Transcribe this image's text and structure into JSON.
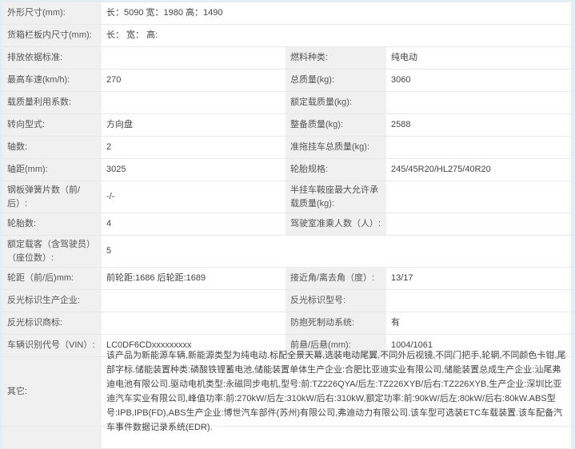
{
  "rows": [
    {
      "l1": "外形尺寸(mm):",
      "v1": "长：5090 宽：1980 高：1490"
    },
    {
      "l1": "货箱栏板内尺寸(mm):",
      "v1": "长： 宽： 高:"
    },
    {
      "l1": "排放依据标准:",
      "v1": "",
      "l2": "燃料种类:",
      "v2": "纯电动"
    },
    {
      "l1": "最高车速(km/h):",
      "v1": "270",
      "l2": "总质量(kg):",
      "v2": "3060"
    },
    {
      "l1": "载质量利用系数:",
      "v1": "",
      "l2": "额定载质量(kg):",
      "v2": ""
    },
    {
      "l1": "转向型式:",
      "v1": "方向盘",
      "l2": "整备质量(kg):",
      "v2": "2588"
    },
    {
      "l1": "轴数:",
      "v1": "2",
      "l2": "准拖挂车总质量(kg):",
      "v2": ""
    },
    {
      "l1": "轴距(mm):",
      "v1": "3025",
      "l2": "轮胎规格:",
      "v2": "245/45R20/HL275/40R20"
    },
    {
      "l1": "钢板弹簧片数（前/后）:",
      "v1": "-/-",
      "l2": "半挂车鞍座最大允许承载质量(kg):",
      "v2": ""
    },
    {
      "l1": "轮胎数:",
      "v1": "4",
      "l2": "驾驶室准乘人数（人）:",
      "v2": ""
    },
    {
      "l1": "额定载客（含驾驶员）（座位数）:",
      "v1": "5"
    },
    {
      "l1": "轮距（前/后)mm:",
      "v1": "前轮距:1686 后轮距:1689",
      "l2": "接近角/离去角（度）:",
      "v2": "13/17"
    },
    {
      "l1": "反光标识生产企业:",
      "v1": "",
      "l2": "反光标识型号:",
      "v2": ""
    },
    {
      "l1": "反光标识商标:",
      "v1": "",
      "l2": "防抱死制动系统:",
      "v2": "有"
    },
    {
      "l1": "车辆识别代号（VIN）:",
      "v1": "LC0DF6CDxxxxxxxxx",
      "l2": "前悬/后悬(mm):",
      "v2": "1004/1061"
    },
    {
      "l1": "其它:",
      "v1": "该产品为新能源车辆,新能源类型为纯电动.标配全景天幕,选装电动尾翼,不同外后视镜,不同门把手,轮辋,不同颜色卡钳,尾部字标.储能装置种类:磷酸铁锂蓄电池,储能装置单体生产企业:合肥比亚迪实业有限公司,储能装置总成生产企业:汕尾弗迪电池有限公司.驱动电机类型:永磁同步电机,型号:前:TZ226QYA/后左:TZ226XYB/后右:TZ226XYB,生产企业:深圳比亚迪汽车实业有限公司,峰值功率:前:270kW/后左:310kW/后右:310kW,额定功率:前:90kW/后左:80kW/后右:80kW.ABS型号:IPB,IPB(FD),ABS生产企业:博世汽车部件(苏州)有限公司,弗迪动力有限公司.该车型可选装ETC车载装置.该车配备汽车事件数据记录系统(EDR)."
    }
  ]
}
